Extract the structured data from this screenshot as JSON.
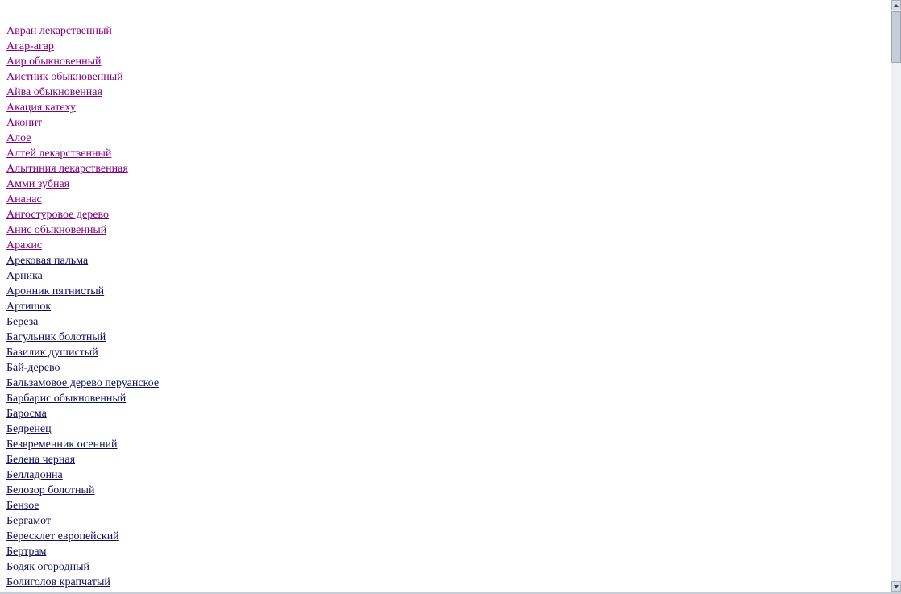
{
  "links": [
    {
      "label": "Авран лекарственный",
      "visited": true
    },
    {
      "label": "Агар-агар",
      "visited": true
    },
    {
      "label": "Аир обыкновенный",
      "visited": true
    },
    {
      "label": "Аистник обыкновенный",
      "visited": true
    },
    {
      "label": "Айва обыкновенная",
      "visited": true
    },
    {
      "label": "Акация катеху",
      "visited": true
    },
    {
      "label": "Аконит",
      "visited": true
    },
    {
      "label": "Алое",
      "visited": true
    },
    {
      "label": "Алтей лекарственный",
      "visited": true
    },
    {
      "label": "Алытиния лекарственная",
      "visited": true
    },
    {
      "label": "Амми зубная",
      "visited": true
    },
    {
      "label": "Ананас",
      "visited": true
    },
    {
      "label": "Ангостуровое дерево",
      "visited": true
    },
    {
      "label": "Анис обыкновенный",
      "visited": true
    },
    {
      "label": "Арахис",
      "visited": true
    },
    {
      "label": "Арековая пальма",
      "visited": false
    },
    {
      "label": "Арника",
      "visited": false
    },
    {
      "label": "Аронник пятнистый",
      "visited": false
    },
    {
      "label": "Артишок",
      "visited": false
    },
    {
      "label": "Береза",
      "visited": false
    },
    {
      "label": "Багульник болотный",
      "visited": false
    },
    {
      "label": "Базилик душистый",
      "visited": false
    },
    {
      "label": "Бай-дерево",
      "visited": false
    },
    {
      "label": "Бальзамовое дерево перуанское",
      "visited": false
    },
    {
      "label": "Барбарис обыкновенный",
      "visited": false
    },
    {
      "label": "Баросма",
      "visited": false
    },
    {
      "label": "Бедренец",
      "visited": false
    },
    {
      "label": "Безвременник осенний",
      "visited": false
    },
    {
      "label": "Белена черная",
      "visited": false
    },
    {
      "label": "Белладонна",
      "visited": false
    },
    {
      "label": "Белозор болотный",
      "visited": false
    },
    {
      "label": "Бензое",
      "visited": false
    },
    {
      "label": "Бергамот",
      "visited": false
    },
    {
      "label": "Бересклет европейский",
      "visited": false
    },
    {
      "label": "Бертрам",
      "visited": false
    },
    {
      "label": "Бодяк огородный",
      "visited": false
    },
    {
      "label": "Болиголов крапчатый",
      "visited": false
    }
  ],
  "colors": {
    "visited_link": "#800080",
    "unvisited_link": "#10105a",
    "background": "#ffffff"
  },
  "scrollbar": {
    "up_icon": "arrow-up",
    "down_icon": "arrow-down"
  }
}
